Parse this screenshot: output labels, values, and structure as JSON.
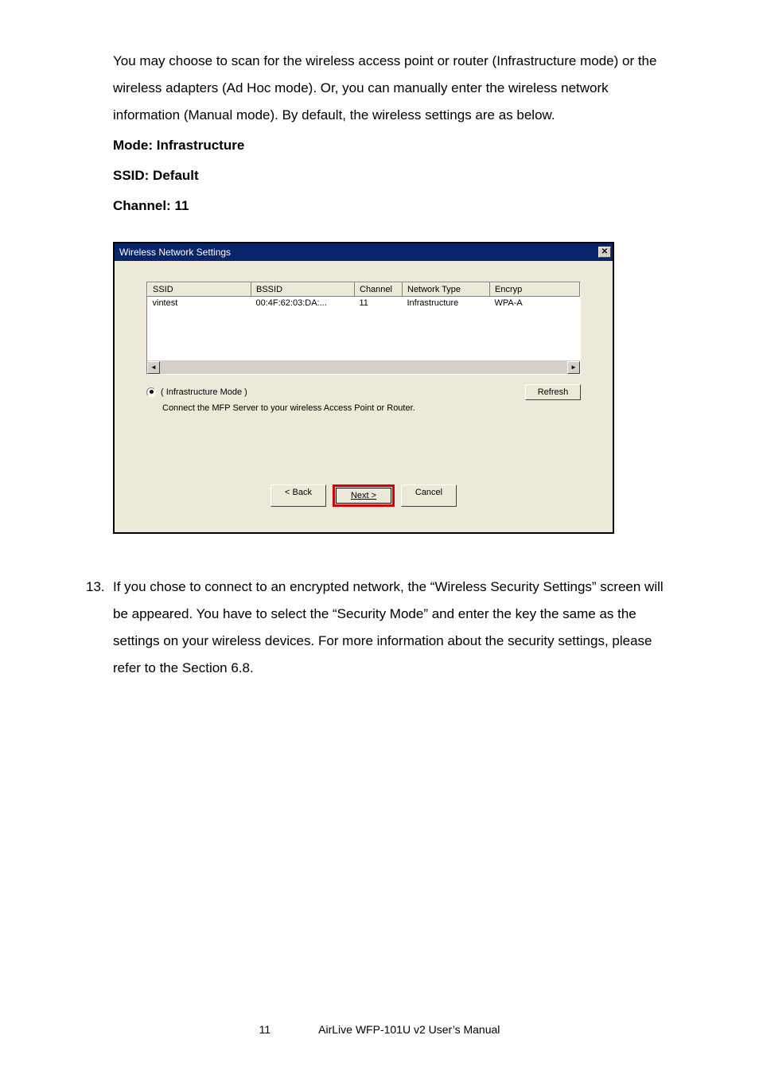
{
  "intro": {
    "p1": "You may choose to scan for the wireless access point or router (Infrastructure mode) or the wireless adapters (Ad Hoc mode). Or, you can manually enter the wireless network information (Manual mode). By default, the wireless settings are as below.",
    "mode_line": "Mode: Infrastructure",
    "ssid_line": "SSID: Default",
    "channel_line": "Channel: 11"
  },
  "dialog": {
    "title": "Wireless Network Settings",
    "close_glyph": "✕",
    "headers": {
      "ssid": "SSID",
      "bssid": "BSSID",
      "channel": "Channel",
      "type": "Network Type",
      "encryp": "Encryp"
    },
    "row": {
      "ssid": "vintest",
      "bssid": "00:4F:62:03:DA:...",
      "channel": "11",
      "type": "Infrastructure",
      "encryp": "WPA-A"
    },
    "scroll_left": "◄",
    "scroll_right": "►",
    "radio_label": "( Infrastructure Mode )",
    "mode_desc": "Connect the MFP Server to your wireless Access Point or Router.",
    "refresh_label": "Refresh",
    "back_label": "< Back",
    "next_label": "Next >",
    "cancel_label": "Cancel"
  },
  "step13": {
    "num": "13.",
    "text": "If you chose to connect to an encrypted network, the “Wireless Security Settings” screen will be appeared. You have to select the “Security Mode” and enter the key the same as the settings on your wireless devices. For more information about the security settings, please refer to the Section 6.8."
  },
  "footer": {
    "page": "11",
    "product": "AirLive WFP-101U v2 User’s Manual"
  }
}
